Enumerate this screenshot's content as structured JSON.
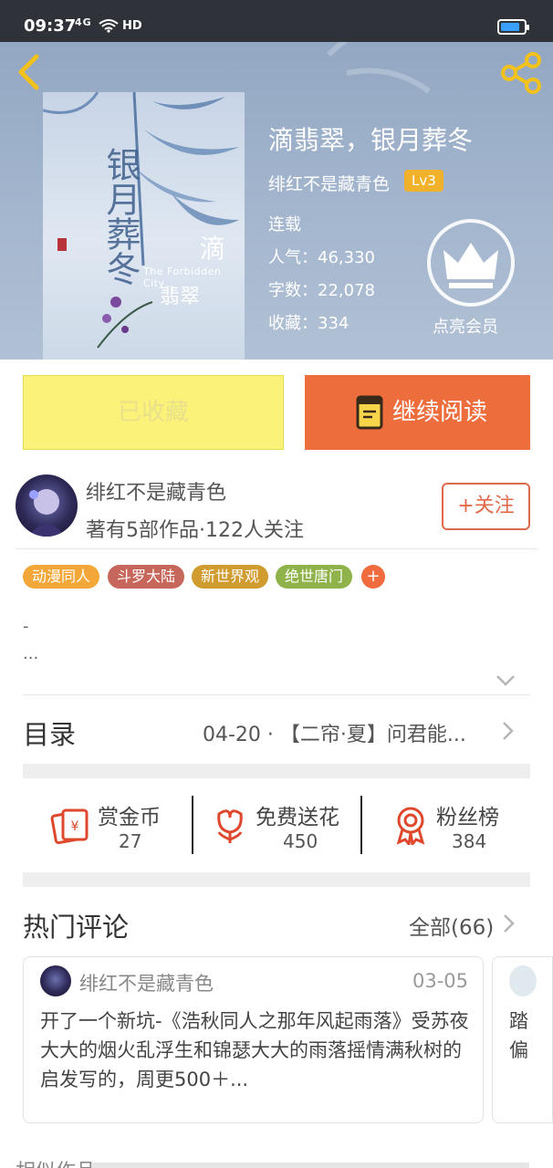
{
  "status_bar": {
    "time": "09:37",
    "signal": "4G",
    "network_badge": "HD",
    "battery_level": 0.85
  },
  "header": {
    "back_icon": "chevron-left-icon",
    "share_icon": "share-icon",
    "accent": "#f2c21b"
  },
  "cover": {
    "vertical_title": "银月葬冬",
    "small_title_a": "滴",
    "english_subtitle": "The Forbidden City",
    "small_title_b": "翡翠"
  },
  "book": {
    "title": "滴翡翠，银月葬冬",
    "author": "绯红不是藏青色",
    "level": "Lv3",
    "status": "连载",
    "popularity_label": "人气：",
    "popularity": "46,330",
    "words_label": "字数：",
    "words": "22,078",
    "favorites_label": "收藏：",
    "favorites": "334",
    "vip_label": "点亮会员"
  },
  "actions": {
    "collected": "已收藏",
    "continue_read": "继续阅读"
  },
  "author_card": {
    "name": "绯红不是藏青色",
    "stats": "著有5部作品·122人关注",
    "follow": "+关注"
  },
  "tags": [
    {
      "label": "动漫同人",
      "color": "#f2a738"
    },
    {
      "label": "斗罗大陆",
      "color": "#c7665a"
    },
    {
      "label": "新世界观",
      "color": "#d09b2f"
    },
    {
      "label": "绝世唐门",
      "color": "#8fb34a"
    }
  ],
  "tag_add": "+",
  "intro": {
    "line1": "-",
    "line2": "..."
  },
  "catalog": {
    "label": "目录",
    "latest": "04-20 · 【二帘·夏】问君能..."
  },
  "stats": [
    {
      "label": "赏金币",
      "value": "27",
      "icon": "red-envelope-icon"
    },
    {
      "label": "免费送花",
      "value": "450",
      "icon": "flower-icon"
    },
    {
      "label": "粉丝榜",
      "value": "384",
      "icon": "medal-icon"
    }
  ],
  "comments": {
    "title": "热门评论",
    "all": "全部(66)",
    "items": [
      {
        "user": "绯红不是藏青色",
        "date": "03-05",
        "text": "开了一个新坑-《浩秋同人之那年风起雨落》受苏夜大大的烟火乱浮生和锦瑟大大的雨落摇情满秋树的启发写的，周更500＋..."
      },
      {
        "text": "踏偏"
      }
    ]
  },
  "similar": {
    "title": "相似作品"
  }
}
